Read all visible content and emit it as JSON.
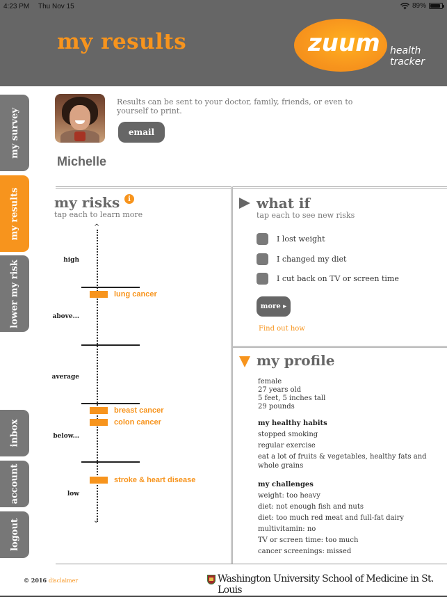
{
  "status_bar": {
    "time": "4:23 PM",
    "date": "Thu Nov 15",
    "battery": "89%",
    "battery_level": 0.89,
    "wifi_icon": "wifi-icon"
  },
  "header": {
    "title": "my results",
    "logo": {
      "brand": "zuum",
      "line1": "health",
      "line2": "tracker"
    }
  },
  "sidebar": {
    "tabs": [
      {
        "label": "my survey",
        "active": false
      },
      {
        "label": "my results",
        "active": true
      },
      {
        "label": "lower my risk",
        "active": false
      },
      {
        "label": "inbox",
        "active": false
      },
      {
        "label": "account",
        "active": false
      },
      {
        "label": "logout",
        "active": false
      }
    ]
  },
  "user": {
    "name": "Michelle",
    "send_note": "Results can be sent to your doctor, family, friends, or even to yourself to print.",
    "email_label": "email"
  },
  "risks": {
    "title": "my risks",
    "subtitle": "tap each to learn more",
    "info_glyph": "i",
    "levels": [
      "high",
      "above...",
      "average",
      "below...",
      "low"
    ],
    "items": [
      {
        "label": "lung cancer",
        "level": "above..."
      },
      {
        "label": "breast cancer",
        "level": "below..."
      },
      {
        "label": "colon cancer",
        "level": "below..."
      },
      {
        "label": "stroke & heart disease",
        "level": "low"
      }
    ]
  },
  "what_if": {
    "title": "what if",
    "subtitle": "tap each to see new risks",
    "options": [
      {
        "label": "I lost weight",
        "checked": false
      },
      {
        "label": "I changed my diet",
        "checked": false
      },
      {
        "label": "I cut back on TV or screen time",
        "checked": false
      }
    ],
    "more_label": "more ▸",
    "find_out_label": "Find out how"
  },
  "profile": {
    "title": "my profile",
    "basics": [
      "female",
      "27 years old",
      "5 feet, 5 inches tall",
      "29 pounds"
    ],
    "habits_heading": "my healthy habits",
    "habits": [
      "stopped smoking",
      "regular exercise",
      "eat a lot of fruits & vegetables, healthy fats and",
      "whole grains"
    ],
    "challenges_heading": "my challenges",
    "challenges": [
      "weight: too heavy",
      "diet: not enough fish and nuts",
      "diet: too much red meat and full-fat dairy",
      "multivitamin: no",
      "TV or screen time: too much",
      "cancer screenings: missed"
    ]
  },
  "footer": {
    "copyright": "© 2016",
    "disclaimer": "disclaimer",
    "institution": "Washington University School of Medicine in St. Louis"
  },
  "colors": {
    "accent": "#f7941d",
    "header_bg": "#666666",
    "tab_bg": "#777777"
  }
}
